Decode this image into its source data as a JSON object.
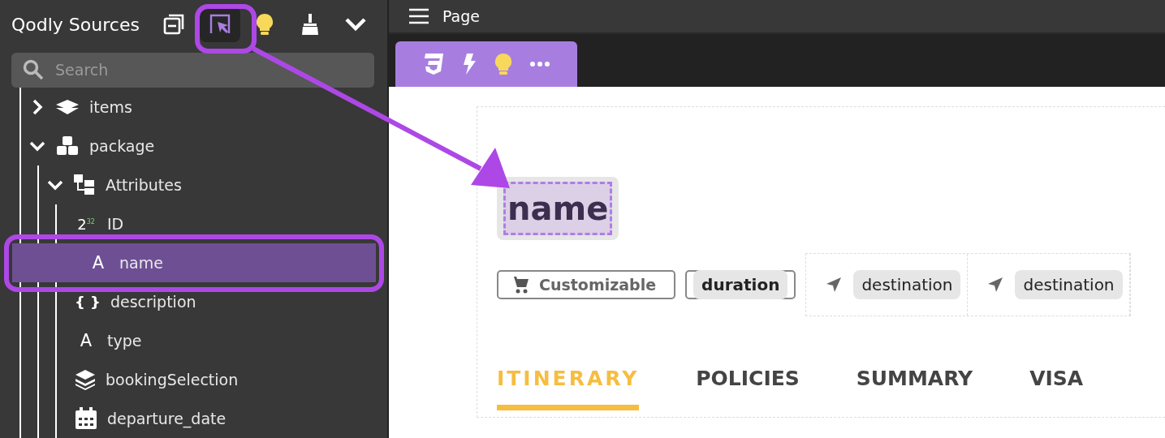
{
  "sidebar": {
    "title": "Qodly Sources",
    "toolbar": [
      {
        "kind": "collapse",
        "active": false
      },
      {
        "kind": "select",
        "active": true
      },
      {
        "kind": "bulb",
        "active": false
      },
      {
        "kind": "broom",
        "active": false
      },
      {
        "kind": "chevron",
        "active": false
      }
    ],
    "search": {
      "placeholder": "Search"
    },
    "tree": [
      {
        "label": "items",
        "kind": "dataclass",
        "expanded": false
      },
      {
        "label": "package",
        "kind": "package",
        "expanded": true,
        "children": [
          {
            "label": "Attributes",
            "kind": "attributes",
            "expanded": true,
            "children": [
              {
                "label": "ID",
                "kind": "number",
                "type_mark": "2",
                "type_sup": "32",
                "selected": false
              },
              {
                "label": "name",
                "kind": "text",
                "type_mark": "A",
                "selected": true
              },
              {
                "label": "description",
                "kind": "object",
                "type_mark": "{ }",
                "selected": false
              },
              {
                "label": "type",
                "kind": "text",
                "type_mark": "A",
                "selected": false
              },
              {
                "label": "bookingSelection",
                "kind": "relation",
                "selected": false
              },
              {
                "label": "departure_date",
                "kind": "date",
                "selected": false
              }
            ]
          }
        ]
      }
    ]
  },
  "editor": {
    "title": "Page",
    "tab_tools": [
      {
        "kind": "css"
      },
      {
        "kind": "bolt"
      },
      {
        "kind": "bulb"
      },
      {
        "kind": "more"
      }
    ],
    "canvas": {
      "heading": {
        "text": "name",
        "selected": true
      },
      "chips": [
        {
          "kind": "tag",
          "text": "Customizable"
        },
        {
          "kind": "boxed",
          "text": "duration"
        },
        {
          "kind": "location",
          "text": "destination"
        },
        {
          "kind": "location",
          "text": "destination"
        }
      ],
      "tabs": [
        {
          "label": "ITINERARY",
          "selected": true
        },
        {
          "label": "POLICIES",
          "selected": false
        },
        {
          "label": "SUMMARY",
          "selected": false
        },
        {
          "label": "VISA",
          "selected": false
        }
      ]
    }
  }
}
